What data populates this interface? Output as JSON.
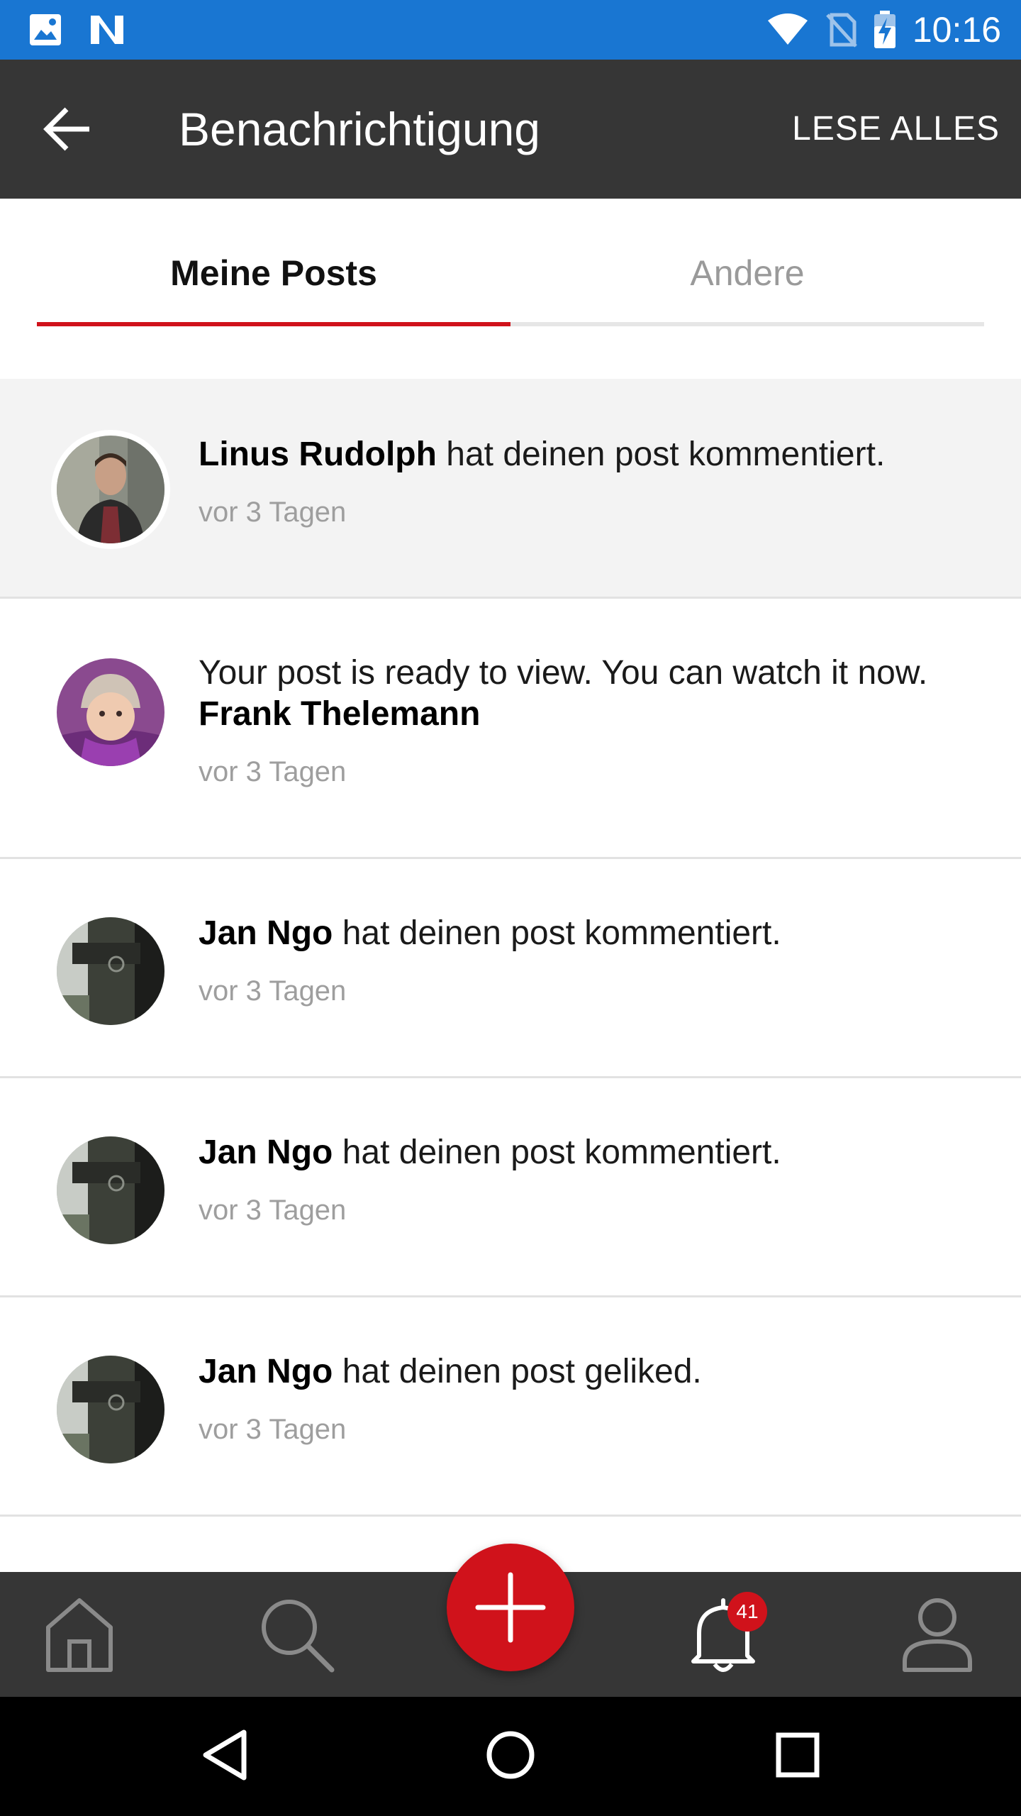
{
  "status_bar": {
    "time": "10:16"
  },
  "app_bar": {
    "title": "Benachrichtigung",
    "read_all": "LESE ALLES"
  },
  "tabs": [
    {
      "label": "Meine Posts",
      "selected": true
    },
    {
      "label": "Andere",
      "selected": false
    }
  ],
  "notifications": [
    {
      "name": "Linus Rudolph",
      "text": " hat deinen post kommentiert.",
      "time": "vor 3 Tagen",
      "unread": true,
      "avatar": "man-portrait"
    },
    {
      "pre": "Your post is ready to view. You can watch it now.",
      "name": "Frank Thelemann",
      "time": "vor 3 Tagen",
      "avatar": "child-portrait"
    },
    {
      "name": "Jan Ngo",
      "text": " hat deinen post kommentiert.",
      "time": "vor 3 Tagen",
      "avatar": "door-photo"
    },
    {
      "name": "Jan Ngo",
      "text": " hat deinen post kommentiert.",
      "time": "vor 3 Tagen",
      "avatar": "door-photo"
    },
    {
      "name": "Jan Ngo",
      "text": " hat deinen post geliked.",
      "time": "vor 3 Tagen",
      "avatar": "door-photo"
    }
  ],
  "bottom_nav": {
    "notification_count": "41"
  },
  "colors": {
    "accent": "#d0121b",
    "status_bar": "#1976d2",
    "app_bar": "#363636"
  }
}
